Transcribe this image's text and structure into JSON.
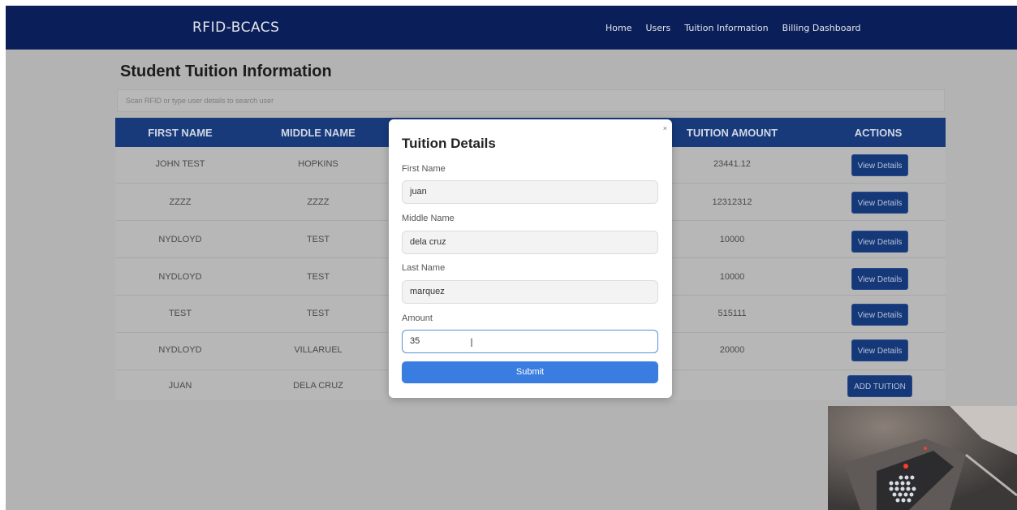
{
  "app": {
    "brand": "RFID-BCACS",
    "nav": [
      "Home",
      "Users",
      "Tuition Information",
      "Billing Dashboard"
    ]
  },
  "page": {
    "title": "Student Tuition Information",
    "search_placeholder": "Scan RFID or type user details to search user"
  },
  "table": {
    "headers": {
      "first": "FIRST NAME",
      "middle": "MIDDLE NAME",
      "amount": "TUITION AMOUNT",
      "actions": "ACTIONS"
    },
    "rows": [
      {
        "first": "JOHN TEST",
        "middle": "HOPKINS",
        "amount": "23441.12",
        "action": "View Details"
      },
      {
        "first": "ZZZZ",
        "middle": "ZZZZ",
        "amount": "12312312",
        "action": "View Details"
      },
      {
        "first": "NYDLOYD",
        "middle": "TEST",
        "amount": "10000",
        "action": "View Details"
      },
      {
        "first": "NYDLOYD",
        "middle": "TEST",
        "amount": "10000",
        "action": "View Details"
      },
      {
        "first": "TEST",
        "middle": "TEST",
        "amount": "515111",
        "action": "View Details"
      },
      {
        "first": "NYDLOYD",
        "middle": "VILLARUEL",
        "amount": "20000",
        "action": "View Details"
      },
      {
        "first": "JUAN",
        "middle": "DELA CRUZ",
        "amount": "",
        "action": "ADD TUITION"
      }
    ]
  },
  "modal": {
    "title": "Tuition Details",
    "close": "×",
    "fields": [
      {
        "label": "First Name",
        "value": "juan"
      },
      {
        "label": "Middle Name",
        "value": "dela cruz"
      },
      {
        "label": "Last Name",
        "value": "marquez"
      },
      {
        "label": "Amount",
        "value": "35"
      }
    ],
    "submit": "Submit"
  },
  "colors": {
    "navbar": "#0a1f59",
    "submit": "#3a7de0",
    "action_button": "#153878"
  }
}
